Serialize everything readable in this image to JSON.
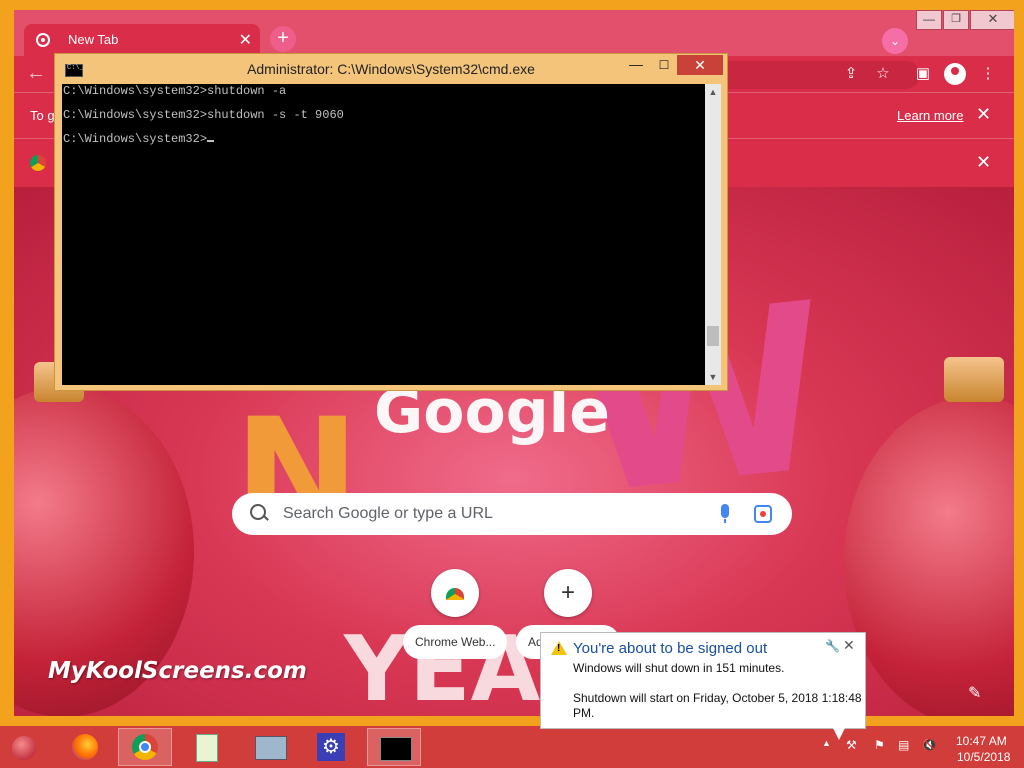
{
  "chrome": {
    "tab_title": "New Tab",
    "tab_close": "✕",
    "new_tab": "+",
    "window_min": "—",
    "window_max": "❐",
    "window_close": "✕",
    "back": "←",
    "share_icon": "⇪",
    "star_icon": "☆",
    "sidepanel_icon": "▣",
    "menu_icon": "⋮",
    "infobar1": {
      "message": "To g",
      "link": "Learn more",
      "close": "✕"
    },
    "infobar2": {
      "close": "✕"
    },
    "ntp": {
      "logo": "Google",
      "search_placeholder": "Search Google or type a URL",
      "shortcuts": [
        {
          "label": "Chrome Web...",
          "icon": "chrome-web-store-icon"
        },
        {
          "label": "Add shortcut",
          "icon": "+"
        }
      ],
      "edit_icon": "✎",
      "watermark": "MyKoolScreens.com"
    }
  },
  "cmd": {
    "title": "Administrator: C:\\Windows\\System32\\cmd.exe",
    "min": "—",
    "max": "☐",
    "close": "✕",
    "scroll_up": "▲",
    "scroll_down": "▼",
    "lines": [
      "C:\\Windows\\system32>shutdown -a",
      "C:\\Windows\\system32>shutdown -s -t 9060",
      "C:\\Windows\\system32>"
    ]
  },
  "notification": {
    "title": "You're about to be signed out",
    "line1": "Windows will shut down in 151 minutes.",
    "line2": "Shutdown will start on Friday, October 5, 2018 1:18:48 PM.",
    "close": "✕"
  },
  "taskbar": {
    "apps": [
      "ornament-start-icon",
      "firefox-icon",
      "chrome-icon",
      "notepad-icon",
      "explorer-icon",
      "settings-icon",
      "cmd-icon"
    ],
    "tray_up": "▲",
    "time": "10:47 AM",
    "date": "10/5/2018"
  },
  "colors": {
    "tab_red": "#d92d49",
    "taskbar": "#d13d3a",
    "cmd_frame": "#f3c47a",
    "link_blue": "#1a4fa0"
  }
}
